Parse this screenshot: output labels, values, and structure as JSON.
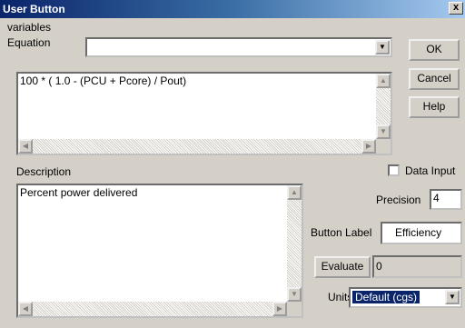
{
  "window": {
    "title": "User Button",
    "close_glyph": "x"
  },
  "variables": {
    "label": "variables",
    "value": ""
  },
  "equation": {
    "label": "Equation",
    "value": "100 * ( 1.0 - (PCU + Pcore) / Pout)"
  },
  "buttons": {
    "ok": "OK",
    "cancel": "Cancel",
    "help": "Help",
    "evaluate": "Evaluate"
  },
  "description": {
    "label": "Description",
    "value": "Percent power delivered"
  },
  "data_input": {
    "label": "Data Input",
    "checked": false
  },
  "precision": {
    "label": "Precision",
    "value": "4"
  },
  "button_label": {
    "label": "Button Label",
    "value": "Efficiency"
  },
  "evaluate_result": {
    "value": "0"
  },
  "units": {
    "label": "Units",
    "selected": "Default (cgs)"
  },
  "icons": {
    "dropdown": "chevron-down-icon",
    "scroll_up": "arrow-up-icon",
    "scroll_down": "arrow-down-icon",
    "scroll_left": "arrow-left-icon",
    "scroll_right": "arrow-right-icon"
  },
  "colors": {
    "titlebar_start": "#0a246a",
    "titlebar_end": "#a6caf0",
    "face": "#d4d0c8",
    "selection": "#0a246a"
  }
}
